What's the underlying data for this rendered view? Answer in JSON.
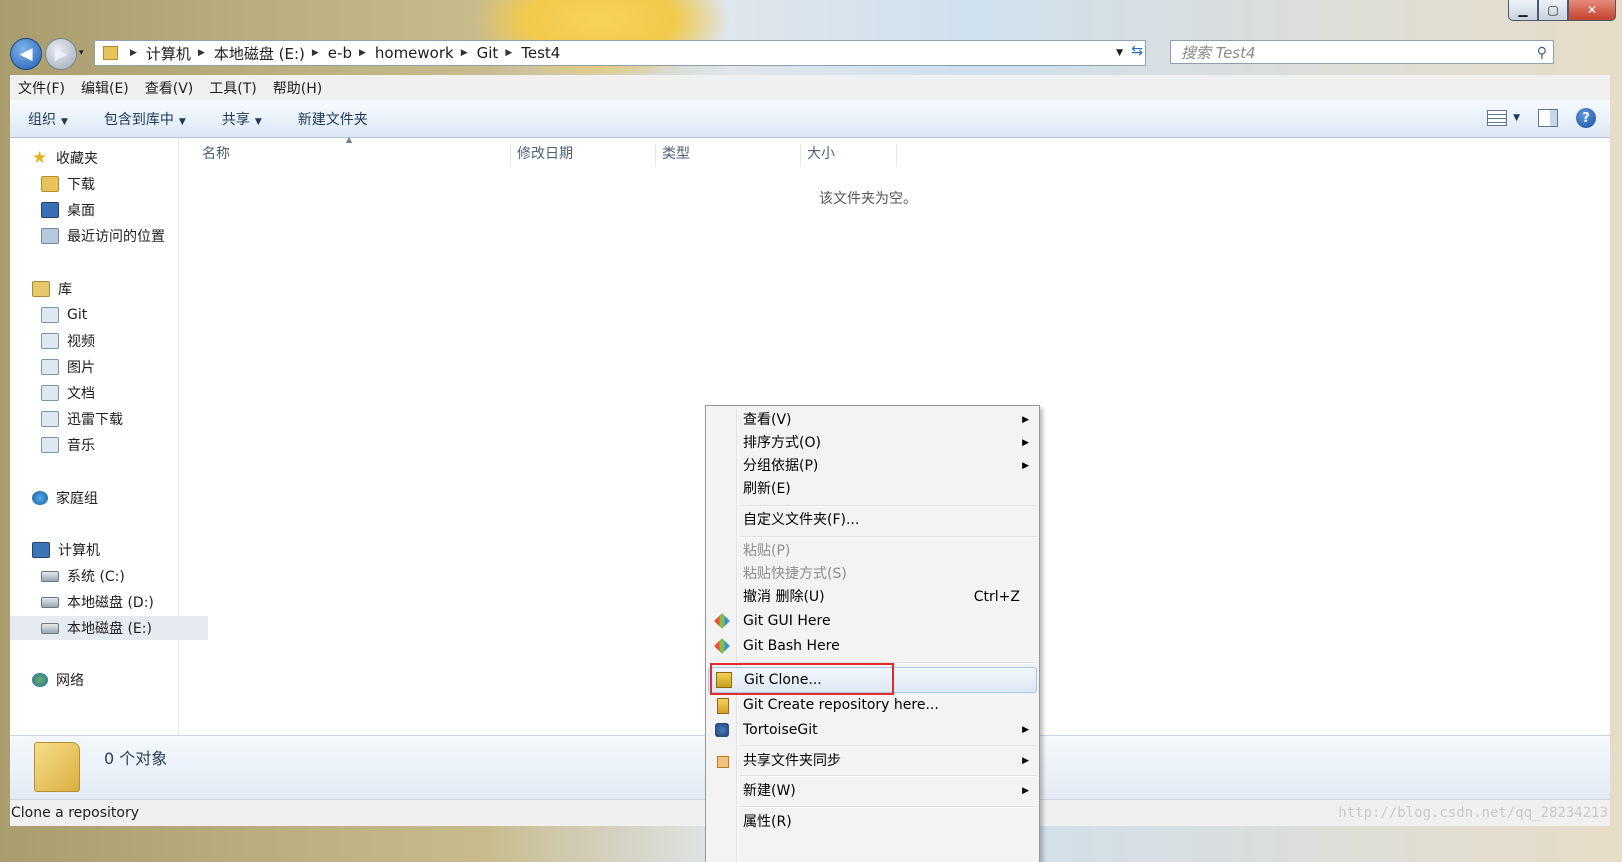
{
  "window": {
    "caption": {
      "minimize": "▁",
      "maximize": "▢",
      "close": "✕"
    }
  },
  "navbar": {
    "back_icon": "◀",
    "forward_icon": "▶",
    "history_caret": "▾",
    "address": {
      "segments": [
        "计算机",
        "本地磁盘 (E:)",
        "e-b",
        "homework",
        "Git",
        "Test4"
      ]
    },
    "search": {
      "placeholder": "搜索 Test4"
    }
  },
  "menubar": {
    "items": [
      "文件(F)",
      "编辑(E)",
      "查看(V)",
      "工具(T)",
      "帮助(H)"
    ]
  },
  "commandbar": {
    "organize": "组织",
    "include_in_library": "包含到库中",
    "share": "共享",
    "new_folder": "新建文件夹",
    "help": "?"
  },
  "nav_pane": {
    "favorites": {
      "label": "收藏夹",
      "items": [
        "下载",
        "桌面",
        "最近访问的位置"
      ]
    },
    "libraries": {
      "label": "库",
      "items": [
        "Git",
        "视频",
        "图片",
        "文档",
        "迅雷下载",
        "音乐"
      ]
    },
    "homegroup": "家庭组",
    "computer": {
      "label": "计算机",
      "items": [
        "系统 (C:)",
        "本地磁盘 (D:)",
        "本地磁盘 (E:)"
      ],
      "selected": "本地磁盘 (E:)"
    },
    "network": "网络"
  },
  "file_pane": {
    "columns": [
      "名称",
      "修改日期",
      "类型",
      "大小"
    ],
    "empty_message": "该文件夹为空。"
  },
  "details": {
    "object_count": "0 个对象"
  },
  "statusbar": {
    "text": "Clone a repository"
  },
  "watermark": "http://blog.csdn.net/qq_28234213",
  "context_menu": {
    "items": [
      {
        "label": "查看(V)",
        "submenu": true
      },
      {
        "label": "排序方式(O)",
        "submenu": true
      },
      {
        "label": "分组依据(P)",
        "submenu": true
      },
      {
        "label": "刷新(E)"
      },
      {
        "label": "自定义文件夹(F)..."
      },
      {
        "label": "粘贴(P)",
        "disabled": true
      },
      {
        "label": "粘贴快捷方式(S)",
        "disabled": true
      },
      {
        "label": "撤消 删除(U)",
        "accelerator": "Ctrl+Z"
      },
      {
        "label": "Git GUI Here",
        "icon": "git-icon"
      },
      {
        "label": "Git Bash Here",
        "icon": "git-icon"
      },
      {
        "label": "Git Clone...",
        "icon": "git-clone-icon",
        "highlighted": true
      },
      {
        "label": "Git Create repository here...",
        "icon": "git-create-icon"
      },
      {
        "label": "TortoiseGit",
        "icon": "tortoisegit-icon",
        "submenu": true
      },
      {
        "label": "共享文件夹同步",
        "icon": "share-sync-icon",
        "submenu": true
      },
      {
        "label": "新建(W)",
        "submenu": true
      },
      {
        "label": "属性(R)"
      }
    ]
  },
  "colors": {
    "highlight_box": "#e32b2b",
    "accent": "#1e395b"
  }
}
